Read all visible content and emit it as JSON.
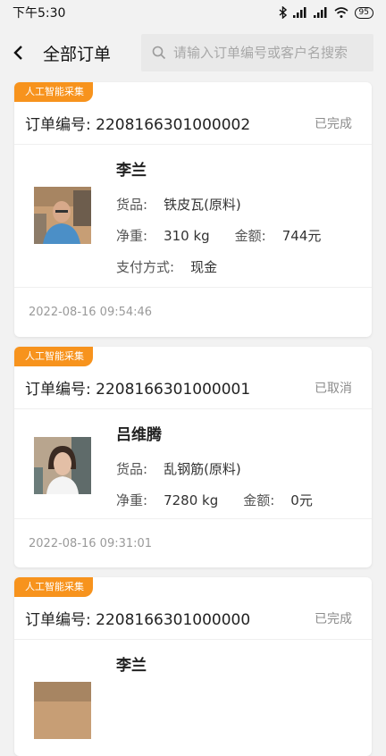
{
  "status_bar": {
    "time": "下午5:30",
    "battery": "95"
  },
  "header": {
    "title": "全部订单"
  },
  "search": {
    "placeholder": "请输入订单编号或客户名搜索"
  },
  "labels": {
    "order_no_prefix": "订单编号: ",
    "goods": "货品:",
    "net_weight": "净重:",
    "amount": "金额:",
    "payment": "支付方式:"
  },
  "orders": [
    {
      "tag": "人工智能采集",
      "order_no": "订单编号: 2208166301000002",
      "status": "已完成",
      "customer": "李兰",
      "goods": "铁皮瓦(原料)",
      "net_weight": "310 kg",
      "amount": "744元",
      "payment": "现金",
      "time": "2022-08-16 09:54:46"
    },
    {
      "tag": "人工智能采集",
      "order_no": "订单编号: 2208166301000001",
      "status": "已取消",
      "customer": "吕维腾",
      "goods": "乱钢筋(原料)",
      "net_weight": "7280 kg",
      "amount": "0元",
      "time": "2022-08-16 09:31:01"
    },
    {
      "tag": "人工智能采集",
      "order_no": "订单编号: 2208166301000000",
      "status": "已完成",
      "customer": "李兰"
    }
  ],
  "colors": {
    "accent": "#f7931d",
    "background": "#f2f2f2"
  },
  "icons": [
    "back-arrow-icon",
    "search-icon",
    "bluetooth-icon",
    "signal-icon",
    "wifi-icon",
    "battery-icon"
  ]
}
